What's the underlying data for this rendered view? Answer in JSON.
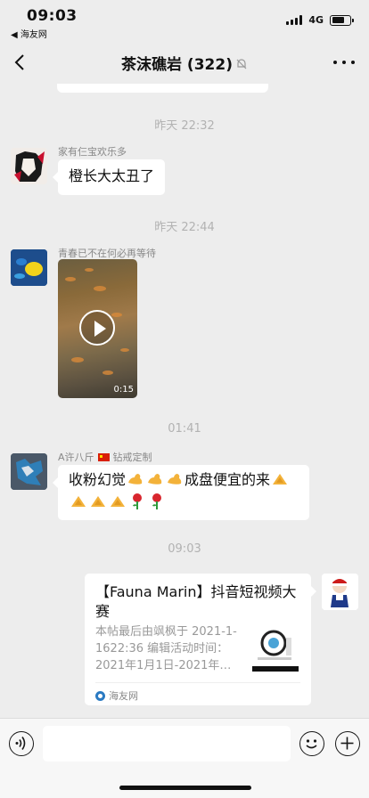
{
  "status": {
    "time": "09:03",
    "back_app": "◀ 海友网",
    "network": "4G"
  },
  "nav": {
    "title": "茶沫礁岩 (322)"
  },
  "messages": [
    {
      "type": "timestamp",
      "text": "昨天 22:32"
    },
    {
      "type": "text",
      "sender": "家有仨宝欢乐多",
      "text": "橙长大太丑了"
    },
    {
      "type": "timestamp",
      "text": "昨天 22:44"
    },
    {
      "type": "video",
      "sender": "青春已不在何必再等待",
      "duration": "0:15"
    },
    {
      "type": "timestamp",
      "text": "01:41"
    },
    {
      "type": "text",
      "sender_name": "A许八斤",
      "sender_suffix": "钻戒定制",
      "text": "收粉幻觉",
      "text_mid": "成盘便宜的来"
    },
    {
      "type": "timestamp",
      "text": "09:03"
    },
    {
      "type": "link_card",
      "title": "【Fauna Marin】抖音短视频大赛",
      "desc": "本帖最后由飒枫于 2021-1-1622:36 编辑活动时间：2021年1月1日-2021年…",
      "source": "海友网"
    }
  ],
  "colors": {
    "background": "#ededed",
    "bubble": "#ffffff",
    "timestamp": "#b2b2b2",
    "sender": "#888888"
  },
  "icons": [
    "back-arrow-icon",
    "mute-icon",
    "more-icon",
    "play-icon",
    "voice-icon",
    "emoji-icon",
    "plus-icon",
    "site-icon"
  ]
}
